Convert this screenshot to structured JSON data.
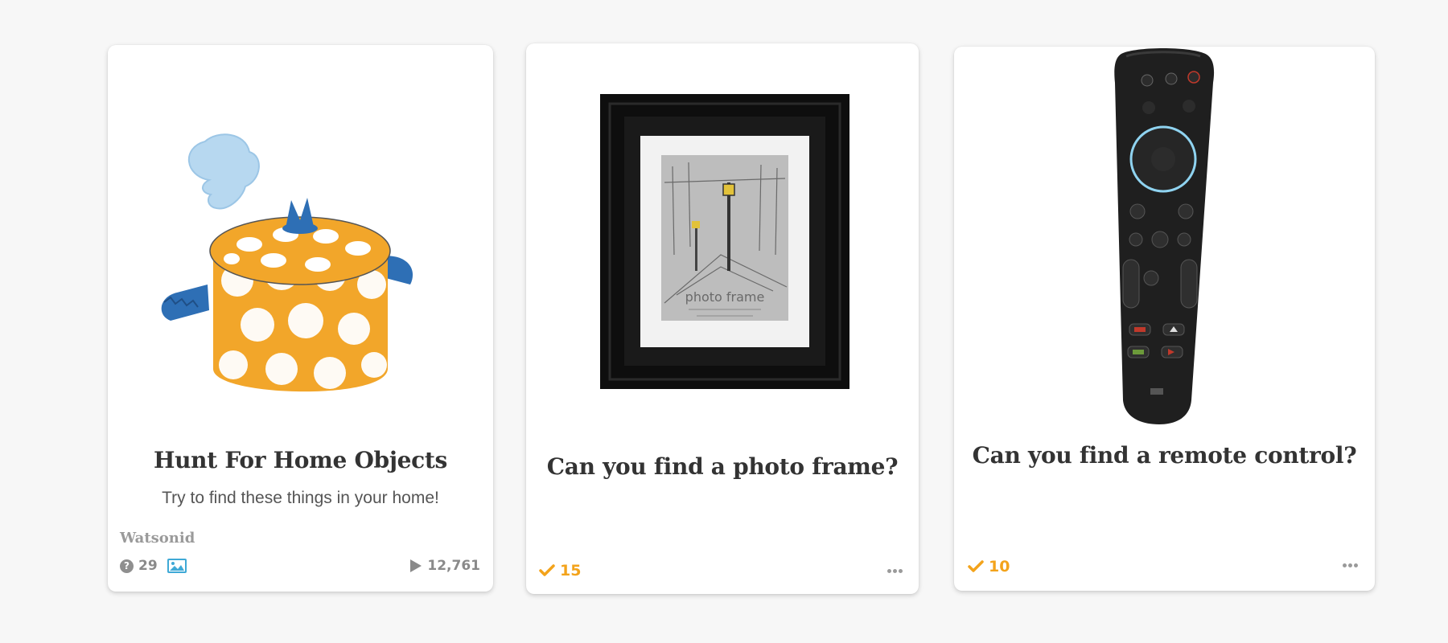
{
  "cards": [
    {
      "title": "Hunt For Home Objects",
      "subtitle": "Try to find these things in your home!",
      "author": "Watsonid",
      "question_count": "29",
      "plays": "12,761",
      "image": "decorative-pot-image",
      "icons": [
        "question-icon",
        "image-icon",
        "play-icon"
      ]
    },
    {
      "title": "Can you find a photo frame?",
      "completed_count": "15",
      "image": "photo-frame-image",
      "image_text": {
        "line1": "photo frame"
      },
      "icons": [
        "checkmark-icon",
        "more-options-icon"
      ]
    },
    {
      "title": "Can you find a remote control?",
      "completed_count": "10",
      "image": "remote-control-image",
      "icons": [
        "checkmark-icon",
        "more-options-icon"
      ]
    }
  ],
  "colors": {
    "accent_orange": "#f3a31b",
    "image_icon_blue": "#3fa9d6",
    "muted_gray": "#8a8a8a"
  }
}
